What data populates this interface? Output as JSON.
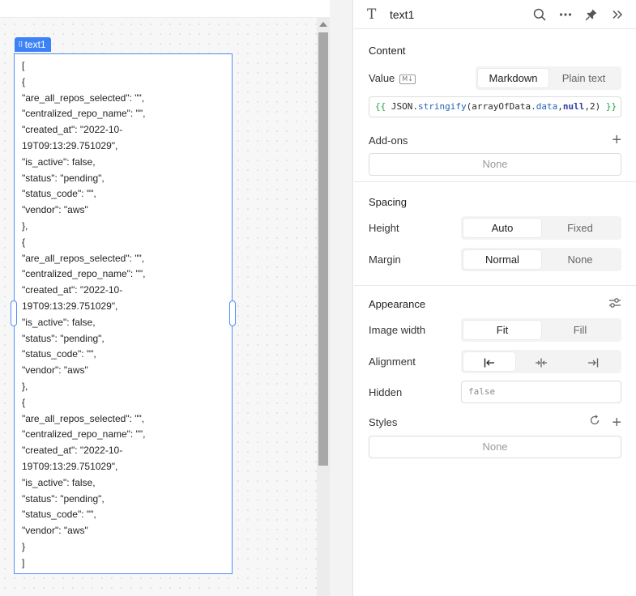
{
  "canvas": {
    "widget_label": "text1",
    "json_lines": [
      "[",
      "{",
      "\"are_all_repos_selected\": \"\",",
      "\"centralized_repo_name\": \"\",",
      "\"created_at\": \"2022-10-",
      "19T09:13:29.751029\",",
      "\"is_active\": false,",
      "\"status\": \"pending\",",
      "\"status_code\": \"\",",
      "\"vendor\": \"aws\"",
      "},",
      "{",
      "\"are_all_repos_selected\": \"\",",
      "\"centralized_repo_name\": \"\",",
      "\"created_at\": \"2022-10-",
      "19T09:13:29.751029\",",
      "\"is_active\": false,",
      "\"status\": \"pending\",",
      "\"status_code\": \"\",",
      "\"vendor\": \"aws\"",
      "},",
      "{",
      "\"are_all_repos_selected\": \"\",",
      "\"centralized_repo_name\": \"\",",
      "\"created_at\": \"2022-10-",
      "19T09:13:29.751029\",",
      "\"is_active\": false,",
      "\"status\": \"pending\",",
      "\"status_code\": \"\",",
      "\"vendor\": \"aws\"",
      "}",
      "]"
    ]
  },
  "inspector": {
    "header": {
      "title": "text1",
      "type_icon": "text-T-icon"
    },
    "content": {
      "section_title": "Content",
      "value_label": "Value",
      "md_badge": "M↓",
      "modes": [
        "Markdown",
        "Plain text"
      ],
      "active_mode": "Markdown",
      "value_parts": {
        "open": "{{",
        "obj": "JSON",
        "dot1": ".",
        "method": "stringify",
        "args_open": "(arrayOfData.",
        "prop": "data",
        "comma1": ",",
        "null_kw": "null",
        "rest": ",2)",
        "close": "}}"
      },
      "addons_label": "Add-ons",
      "addons_value": "None"
    },
    "spacing": {
      "section_title": "Spacing",
      "height_label": "Height",
      "height_options": [
        "Auto",
        "Fixed"
      ],
      "margin_label": "Margin",
      "margin_options": [
        "Normal",
        "None"
      ]
    },
    "appearance": {
      "section_title": "Appearance",
      "image_width_label": "Image width",
      "image_width_options": [
        "Fit",
        "Fill"
      ],
      "alignment_label": "Alignment",
      "hidden_label": "Hidden",
      "hidden_value": "false",
      "styles_label": "Styles",
      "styles_value": "None"
    }
  }
}
